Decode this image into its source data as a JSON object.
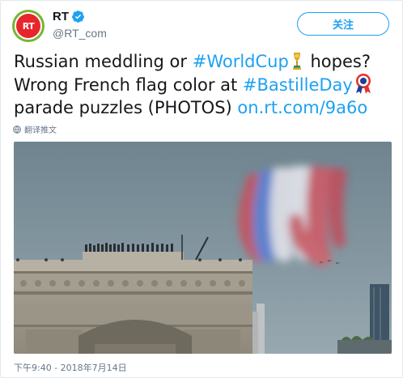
{
  "account": {
    "avatar_text": "RT",
    "display_name": "RT",
    "handle": "@RT_com",
    "verified_icon": "verified-badge-icon"
  },
  "follow_button": {
    "label": "关注"
  },
  "tweet": {
    "line1_text": "Russian meddling or ",
    "hashtag_worldcup": "#WorldCup",
    "line1_after": " hopes?",
    "line2_text": "Wrong French flag color at ",
    "hashtag_bastille": "#BastilleDay",
    "line3_text": "parade puzzles (PHOTOS) ",
    "link": "on.rt.com/9a6o"
  },
  "translate": {
    "label": "翻译推文",
    "icon": "globe-icon"
  },
  "timestamp": "下午9:40 - 2018年7月14日",
  "colors": {
    "link": "#1da1f2",
    "text": "#14171a",
    "secondary": "#657786",
    "rt_red": "#e8252c",
    "rt_green": "#77b531"
  }
}
